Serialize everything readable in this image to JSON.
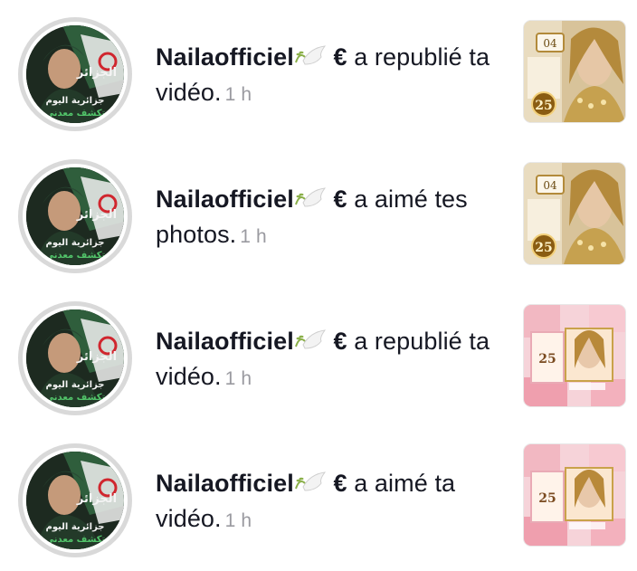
{
  "notifications": [
    {
      "username": "Nailaofficiel",
      "username_suffix": "€",
      "action": "a republié ta vidéo.",
      "time": "1 h",
      "avatar_text_top": "الجزائر",
      "avatar_text_mid": "جزائرية اليوم",
      "avatar_text_bottom": "تكشف معدني",
      "thumb_style": "gold",
      "thumb_badge_top": "04",
      "thumb_badge_bottom": "25"
    },
    {
      "username": "Nailaofficiel",
      "username_suffix": "€",
      "action": "a aimé tes photos.",
      "time": "1 h",
      "avatar_text_top": "الجزائر",
      "avatar_text_mid": "جزائرية اليوم",
      "avatar_text_bottom": "تكشف معدني",
      "thumb_style": "gold",
      "thumb_badge_top": "04",
      "thumb_badge_bottom": "25"
    },
    {
      "username": "Nailaofficiel",
      "username_suffix": "€",
      "action": "a republié ta vidéo.",
      "time": "1 h",
      "avatar_text_top": "الجزائر",
      "avatar_text_mid": "جزائرية اليوم",
      "avatar_text_bottom": "تكشف معدني",
      "thumb_style": "pink",
      "thumb_badge_top": "",
      "thumb_badge_bottom": "25"
    },
    {
      "username": "Nailaofficiel",
      "username_suffix": "€",
      "action": "a aimé ta vidéo.",
      "time": "1 h",
      "avatar_text_top": "الجزائر",
      "avatar_text_mid": "جزائرية اليوم",
      "avatar_text_bottom": "تكشف معدني",
      "thumb_style": "pink",
      "thumb_badge_top": "",
      "thumb_badge_bottom": "25"
    }
  ],
  "icons": {
    "emoji": "dove-olive-branch-icon"
  },
  "colors": {
    "text": "#161823",
    "time": "#9a9aa0",
    "avatar_ring": "#d9d9d9",
    "gold": "#c9a24a",
    "pink": "#f2b8c2"
  }
}
